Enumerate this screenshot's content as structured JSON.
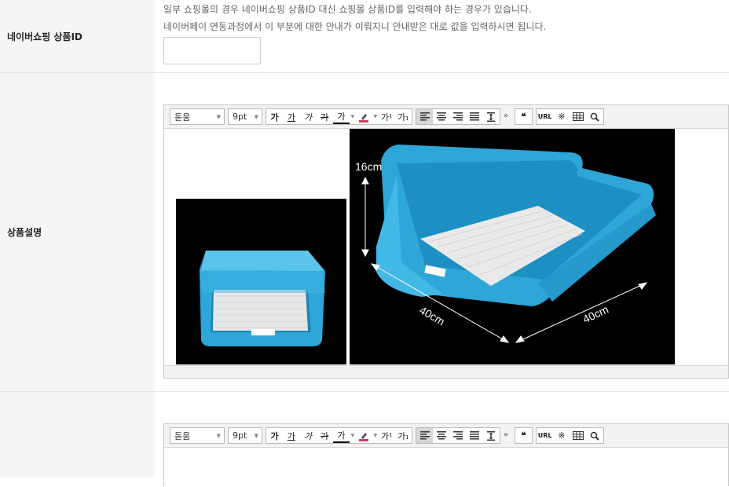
{
  "rows": {
    "naver_id": {
      "label": "네이버쇼핑 상품ID",
      "help_line1": "일부 쇼핑몰의 경우 네이버쇼핑 상품ID 대신 쇼핑몰 상품ID를 입력해야 하는 경우가 있습니다.",
      "help_line2": "네이버페이 연동과정에서 이 부분에 대한 안내가 이뤄지니 안내받은 대로 값을 입력하시면 됩니다.",
      "input_value": ""
    },
    "description": {
      "label": "상품설명"
    },
    "extra": {
      "label": ""
    }
  },
  "editor": {
    "font_family": "돋움",
    "font_size": "9pt",
    "buttons": {
      "bold": "가",
      "underline": "가",
      "italic": "가",
      "strike": "가",
      "font_color": "가",
      "superscript": "가¹",
      "subscript": "가₁",
      "more": "»",
      "quote": "❝",
      "url": "URL",
      "special_char": "※"
    }
  },
  "product_image": {
    "height_label": "16cm",
    "width_label_front": "40cm",
    "width_label_side": "40cm"
  },
  "colors": {
    "label_bg": "#f5f5f5",
    "tray_blue": "#2ea7d8",
    "mesh": "#e8e8e8"
  }
}
